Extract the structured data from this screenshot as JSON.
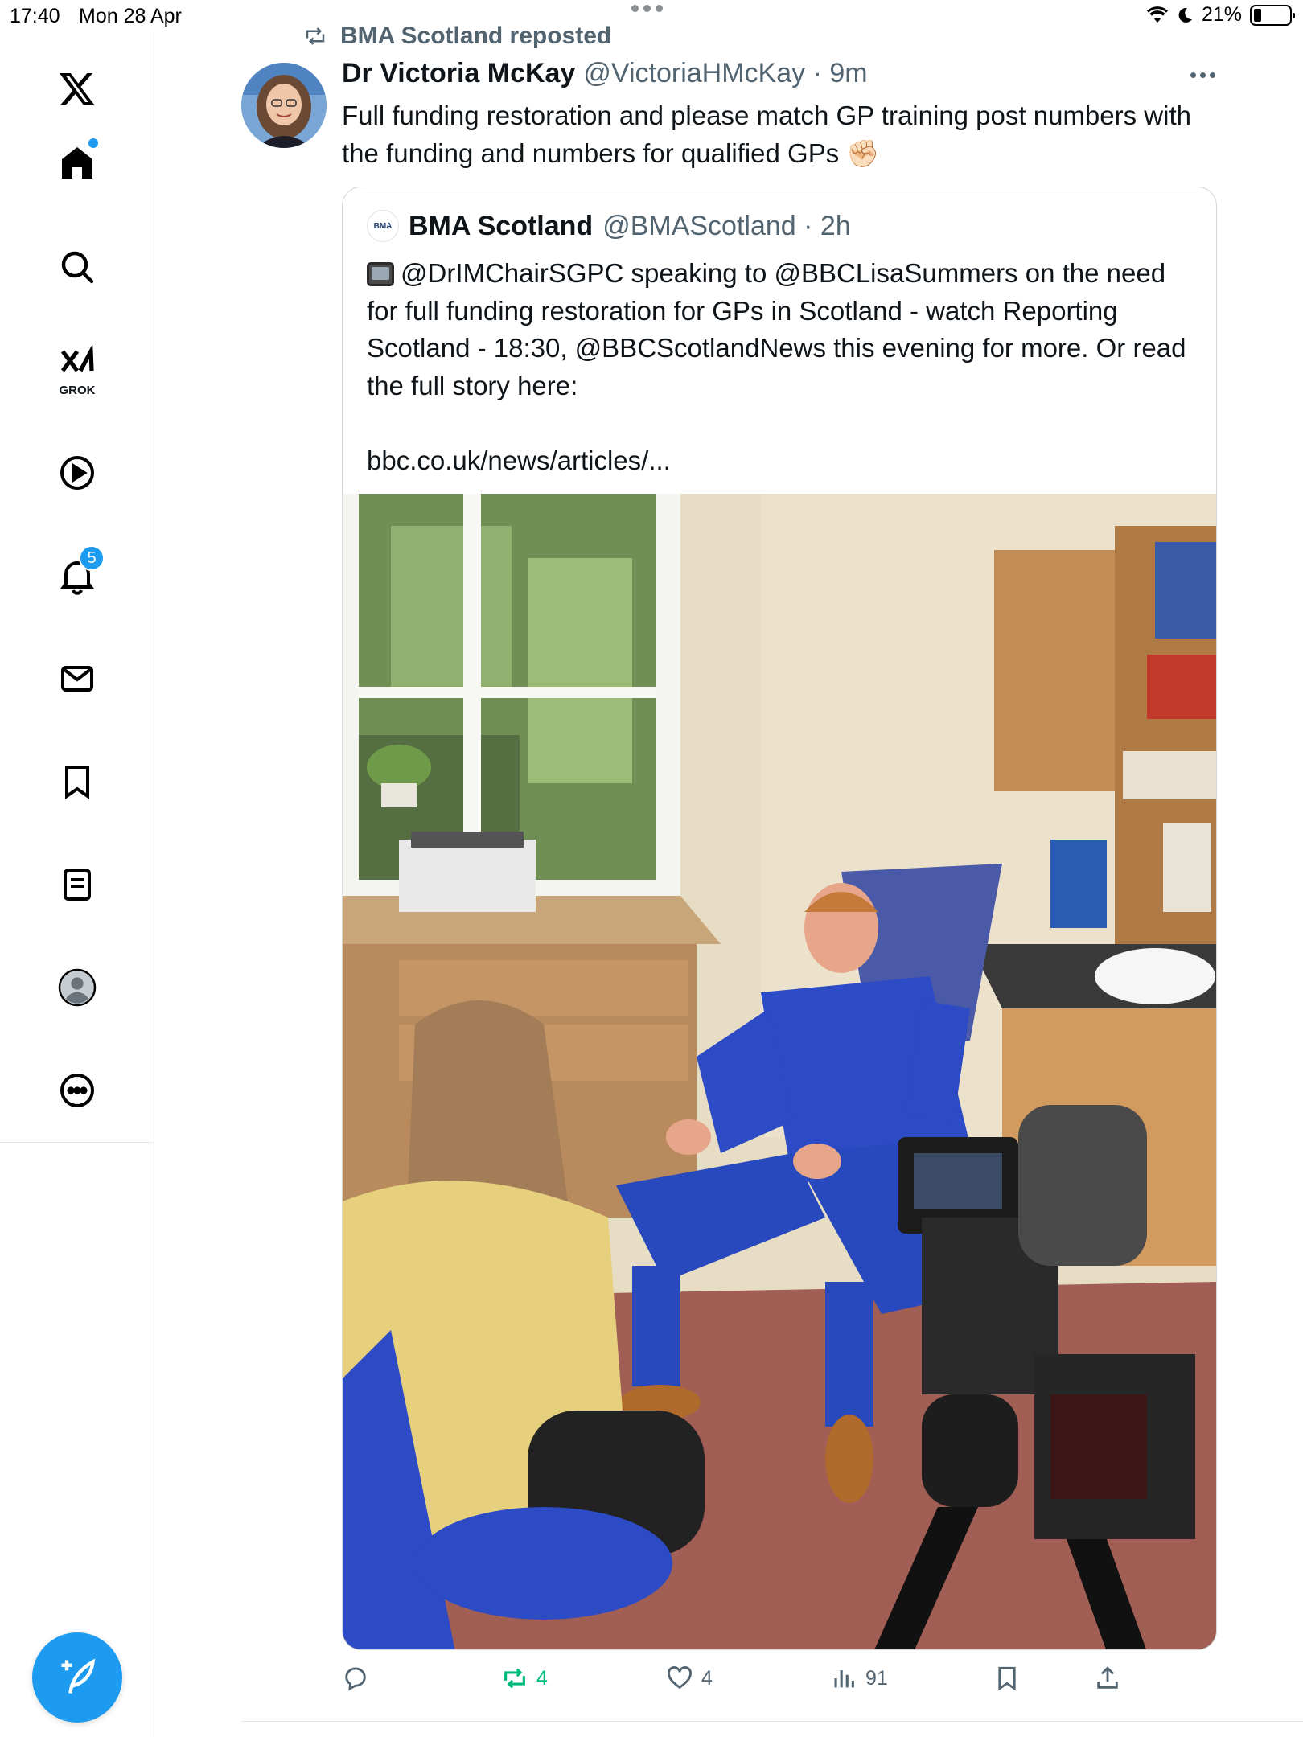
{
  "status_bar": {
    "time": "17:40",
    "date": "Mon 28 Apr",
    "battery": "21%"
  },
  "sidebar": {
    "items": [
      {
        "name": "x-logo-icon"
      },
      {
        "name": "home-icon",
        "has_dot": true
      },
      {
        "name": "search-icon"
      },
      {
        "name": "grok-icon",
        "label": "GROK"
      },
      {
        "name": "video-icon"
      },
      {
        "name": "notifications-icon",
        "badge": "5"
      },
      {
        "name": "messages-icon"
      },
      {
        "name": "bookmarks-icon"
      },
      {
        "name": "lists-icon"
      },
      {
        "name": "profile-icon"
      },
      {
        "name": "more-icon"
      }
    ],
    "compose_icon": "compose-icon"
  },
  "post": {
    "repost_label": "BMA Scotland reposted",
    "author_name": "Dr Victoria McKay",
    "author_meta": "@VictoriaHMcKay · 9m",
    "text": "Full funding restoration and please match GP training post numbers with the funding and numbers for qualified GPs ✊🏻",
    "quote": {
      "avatar_text": "BMA",
      "author_name": "BMA Scotland",
      "author_meta": "@BMAScotland · 2h",
      "text": "@DrIMChairSGPC speaking to @BBCLisaSummers on the need for full funding restoration for GPs in Scotland - watch Reporting Scotland - 18:30, @BBCScotlandNews this evening for more. Or read the full story here:\n\nbbc.co.uk/news/articles/..."
    },
    "actions": {
      "replies": "",
      "reposts": "4",
      "likes": "4",
      "views": "91"
    }
  },
  "colors": {
    "accent": "#1d9bf0",
    "repost_green": "#00ba7c",
    "muted": "#536471"
  }
}
